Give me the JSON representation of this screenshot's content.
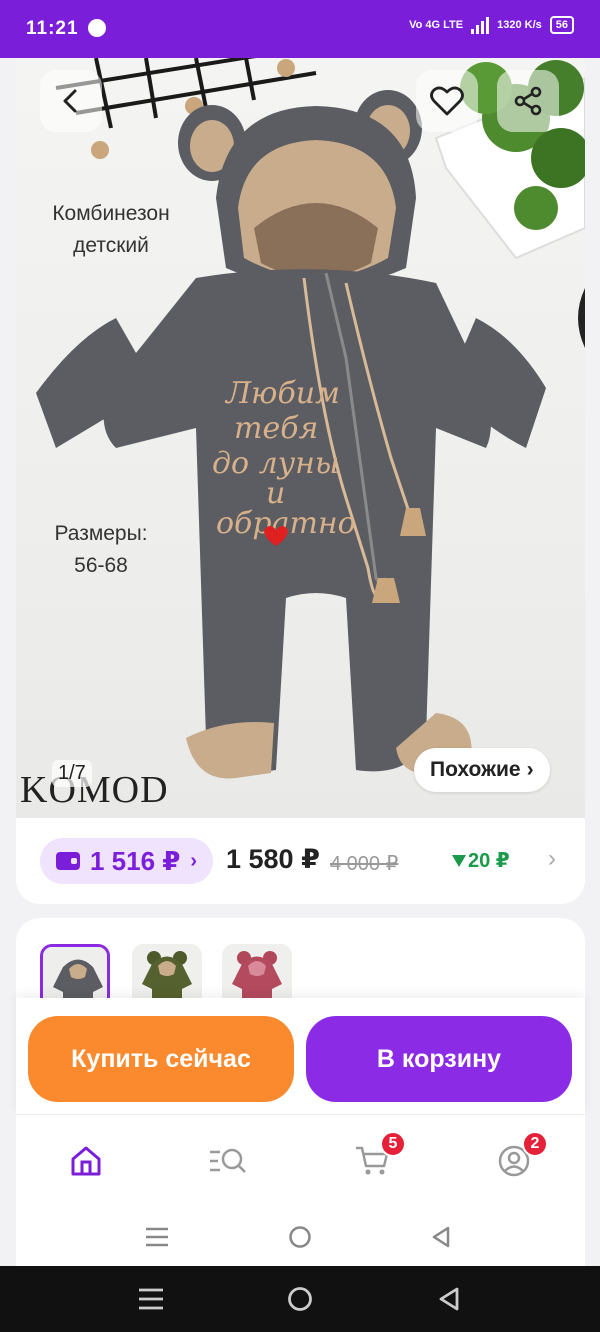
{
  "status_bar": {
    "time": "11:21",
    "network_label": "Vo 4G LTE",
    "speed": "1320 K/s",
    "battery": "56"
  },
  "hero": {
    "title_line1": "Комбинезон",
    "title_line2": "детский",
    "sizes_label": "Размеры:",
    "sizes_value": "56-68",
    "brand": "KOMOD",
    "counter": "1/7",
    "similar_label": "Похожие",
    "embroidery": [
      "Любим",
      "тебя",
      "до луны",
      "и",
      "обратно"
    ]
  },
  "price": {
    "wallet_price": "1 516 ₽",
    "current_price": "1 580 ₽",
    "old_price": "4 000 ₽",
    "cashback": "20 ₽"
  },
  "actions": {
    "buy_now": "Купить сейчас",
    "add_to_cart": "В корзину"
  },
  "nav": {
    "cart_badge": "5",
    "profile_badge": "2"
  },
  "colors": {
    "brand_purple": "#7b1ed9",
    "buy_orange": "#fb8a2e",
    "cart_purple": "#8b2be6",
    "badge_red": "#e5213a",
    "cashback_green": "#1a9a4a"
  },
  "icons": [
    "back-icon",
    "heart-icon",
    "share-icon",
    "wallet-icon",
    "home-icon",
    "catalog-search-icon",
    "cart-icon",
    "profile-icon",
    "menu-icon",
    "home-circle-icon",
    "back-triangle-icon"
  ]
}
